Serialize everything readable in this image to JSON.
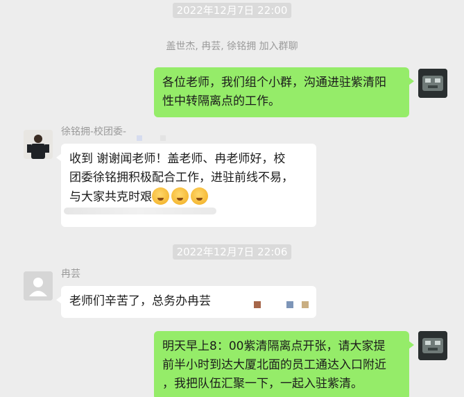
{
  "timestamps": [
    "2022年12月7日 22:00",
    "2022年12月7日 22:06"
  ],
  "system_note": "盖世杰, 冉芸, 徐铭拥 加入群聊",
  "messages": [
    {
      "from": "self",
      "text_lines": [
        "各位老师，我们组个小群，沟通进驻紫清阳",
        "性中转隔离点的工作。"
      ]
    },
    {
      "from": "徐铭拥-校团委-",
      "text_lines": [
        "收到 谢谢闻老师！盖老师、冉老师好，校",
        "团委徐铭拥积极配合工作，进驻前线不易，",
        "与大家共克时艰"
      ],
      "emoji_count": 3,
      "emoji_icon": "grimacing-face-emoji"
    },
    {
      "from": "冉芸",
      "text_lines": [
        "老师们辛苦了，总务办冉芸"
      ]
    },
    {
      "from": "self",
      "text_lines": [
        "明天早上8：00紫清隔离点开张，请大家提",
        "前半小时到达大厦北面的员工通达入口附近",
        "，我把队伍汇聚一下，一起入驻紫清。"
      ]
    }
  ],
  "colors": {
    "background": "#ededed",
    "self_bubble": "#95ec69",
    "other_bubble": "#ffffff",
    "timestamp_bg": "#dadada"
  }
}
